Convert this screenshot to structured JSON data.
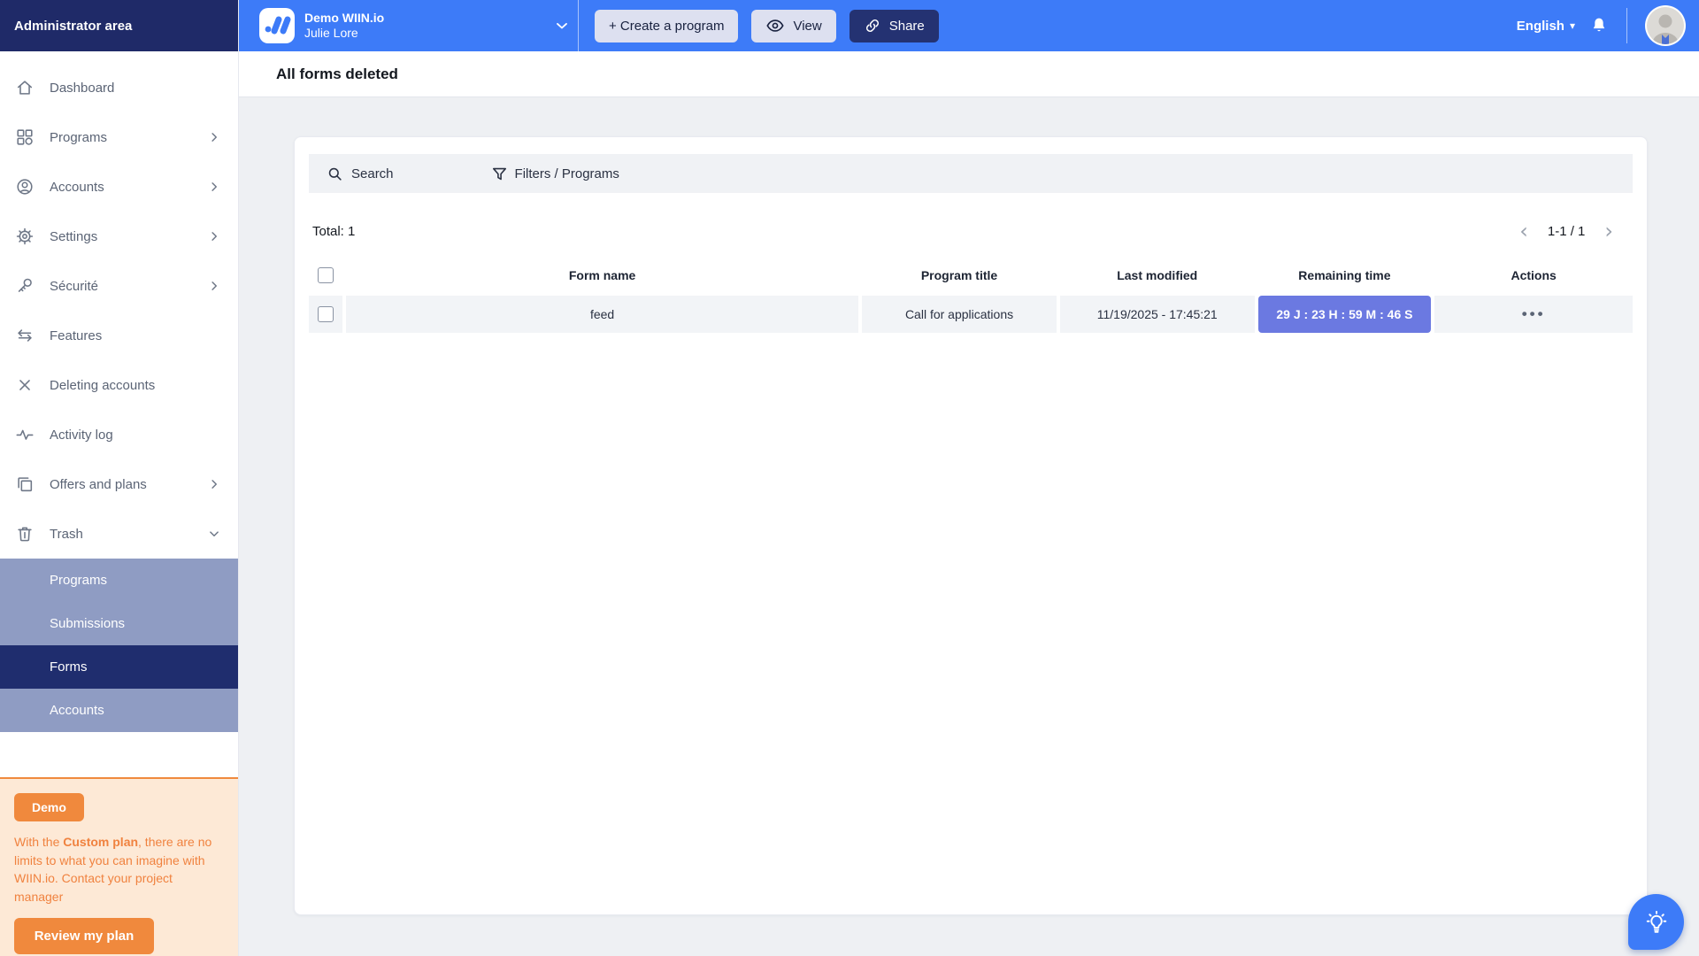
{
  "sidebar": {
    "header": "Administrator area",
    "items": [
      {
        "label": "Dashboard"
      },
      {
        "label": "Programs"
      },
      {
        "label": "Accounts"
      },
      {
        "label": "Settings"
      },
      {
        "label": "Sécurité"
      },
      {
        "label": "Features"
      },
      {
        "label": "Deleting accounts"
      },
      {
        "label": "Activity log"
      },
      {
        "label": "Offers and plans"
      },
      {
        "label": "Trash"
      }
    ],
    "trash_submenu": [
      {
        "label": "Programs",
        "active": false
      },
      {
        "label": "Submissions",
        "active": false
      },
      {
        "label": "Forms",
        "active": true
      },
      {
        "label": "Accounts",
        "active": false
      }
    ],
    "demo": {
      "badge": "Demo",
      "text_prefix": "With the ",
      "text_bold": "Custom plan",
      "text_suffix": ", there are no limits to what you can imagine with WIIN.io. Contact your project manager",
      "review_button": "Review my plan"
    }
  },
  "topbar": {
    "org_name": "Demo WIIN.io",
    "user_name": "Julie Lore",
    "create_button": "+ Create a program",
    "view_button": "View",
    "share_button": "Share",
    "language": "English"
  },
  "page": {
    "title": "All forms deleted"
  },
  "toolbar": {
    "search_label": "Search",
    "filters_label": "Filters / Programs"
  },
  "table": {
    "total": "Total: 1",
    "pagination": "1-1 / 1",
    "columns": {
      "form_name": "Form name",
      "program_title": "Program title",
      "last_modified": "Last modified",
      "remaining_time": "Remaining time",
      "actions": "Actions"
    },
    "rows": [
      {
        "form_name": "feed",
        "program_title": "Call for applications",
        "last_modified": "11/19/2025 - 17:45:21",
        "remaining_time": "29 J : 23 H : 59 M : 46 S"
      }
    ]
  },
  "icons": {
    "prev": "‹",
    "next": "›",
    "ellipsis": "•••",
    "caret": "▾"
  },
  "colors": {
    "topbar_blue": "#3d7bf8",
    "navy": "#1f2a68",
    "submenu_blue": "#8f9cc3",
    "active_navy": "#1f2d6e",
    "badge_indigo": "#6b79e1",
    "orange": "#f0893d",
    "demo_bg": "#fde9d6"
  }
}
